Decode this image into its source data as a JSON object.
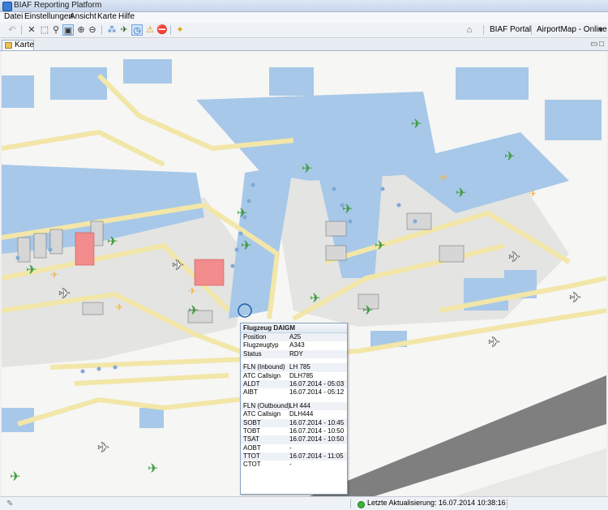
{
  "window": {
    "title": "BIAF Reporting Platform"
  },
  "menu": [
    "Datei",
    "Einstellungen",
    "Ansicht",
    "Karte",
    "Hilfe"
  ],
  "toolbar": {
    "portal_label": "BIAF Portal",
    "map_label": "AirportMap - Online",
    "icons": [
      "undo-icon",
      "cut-icon",
      "select-icon",
      "zoom-icon",
      "zoom-box-icon",
      "zoom-in-icon",
      "zoom-out-icon",
      "layers-icon",
      "flight-icon",
      "clock-icon",
      "warning-icon",
      "stop-icon",
      "settings-icon"
    ]
  },
  "tab": {
    "label": "Karte"
  },
  "popup": {
    "title": "Flugzeug DAIGM",
    "rows": [
      {
        "k": "Position",
        "v": "A25"
      },
      {
        "k": "Flugzeugtyp",
        "v": "A343"
      },
      {
        "k": "Status",
        "v": "RDY"
      },
      {
        "gap": true
      },
      {
        "k": "FLN (Inbound)",
        "v": "LH 785"
      },
      {
        "k": "ATC Callsign",
        "v": "DLH785"
      },
      {
        "k": "ALDT",
        "v": "16.07.2014 - 05:03"
      },
      {
        "k": "AIBT",
        "v": "16.07.2014 - 05:12"
      },
      {
        "gap": true
      },
      {
        "k": "FLN (Outbound)",
        "v": "LH 444"
      },
      {
        "k": "ATC Callsign",
        "v": "DLH444"
      },
      {
        "k": "SOBT",
        "v": "16.07.2014 - 10:45"
      },
      {
        "k": "TOBT",
        "v": "16.07.2014 - 10:50"
      },
      {
        "k": "TSAT",
        "v": "16.07.2014 - 10:50"
      },
      {
        "k": "AOBT",
        "v": "-"
      },
      {
        "k": "TTOT",
        "v": "16.07.2014 - 11:05"
      },
      {
        "k": "CTOT",
        "v": "-"
      }
    ]
  },
  "status": {
    "last_update": "Letzte Aktualisierung: 16.07.2014 10:38:16"
  },
  "colors": {
    "building": "#a7c8e8",
    "apron": "#d6d6d6",
    "taxiway": "#f2e6a8",
    "aircraft_parked": "#3f9a3f",
    "aircraft_taxi": "#f3b64d",
    "highlight": "#f28b8b",
    "runway": "#7f7f7f"
  }
}
